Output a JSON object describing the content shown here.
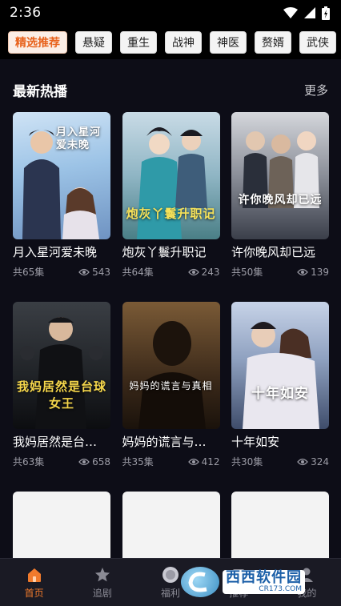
{
  "status_bar": {
    "time": "2:36"
  },
  "categories": [
    "精选推荐",
    "悬疑",
    "重生",
    "战神",
    "神医",
    "赘婿",
    "武侠"
  ],
  "section": {
    "title": "最新热播",
    "more": "更多"
  },
  "dramas": [
    {
      "name": "月入星河爱未晚",
      "episodes": "共65集",
      "views": "543",
      "poster_title": "月入星河爱未晚"
    },
    {
      "name": "炮灰丫鬟升职记",
      "episodes": "共64集",
      "views": "243",
      "poster_title": "炮灰丫鬟升职记"
    },
    {
      "name": "许你晚风却已远",
      "episodes": "共50集",
      "views": "139",
      "poster_title": "许你晚风却已远"
    },
    {
      "name": "我妈居然是台…",
      "episodes": "共63集",
      "views": "658",
      "poster_title": "我妈居然是台球女王"
    },
    {
      "name": "妈妈的谎言与…",
      "episodes": "共35集",
      "views": "412",
      "poster_title": "妈妈的谎言与真相"
    },
    {
      "name": "十年如安",
      "episodes": "共30集",
      "views": "324",
      "poster_title": "十年如安"
    }
  ],
  "colors": {
    "accent": "#f07a2c",
    "background": "#0d0d17"
  },
  "bottom_nav": [
    {
      "label": "首页",
      "icon": "home-icon",
      "active": true
    },
    {
      "label": "追剧",
      "icon": "star-icon",
      "active": false
    },
    {
      "label": "福利",
      "icon": "gift-icon",
      "active": false
    },
    {
      "label": "推荐",
      "icon": "recommend-icon",
      "active": false
    },
    {
      "label": "我的",
      "icon": "profile-icon",
      "active": false
    }
  ],
  "watermark": {
    "brand": "西西软件园",
    "domain": "CR173.COM"
  }
}
